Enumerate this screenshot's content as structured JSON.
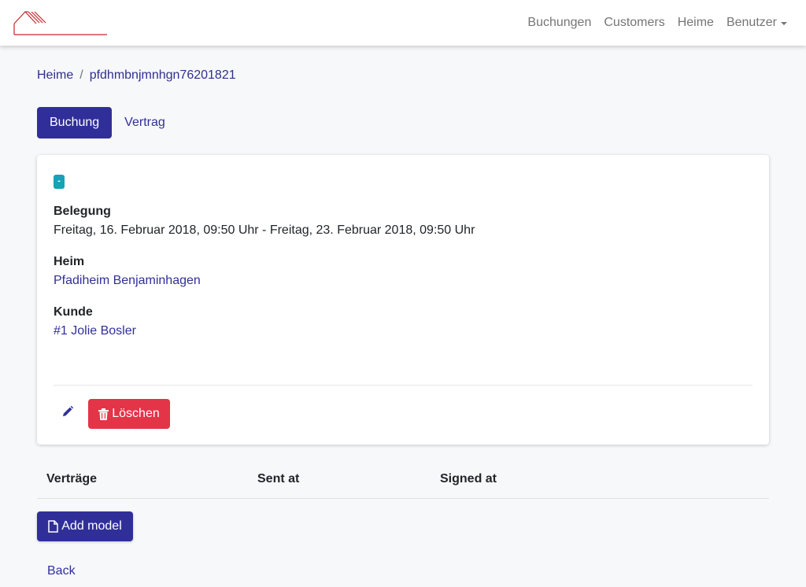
{
  "navbar": {
    "logo_icon": "house-roof-logo",
    "links": [
      {
        "label": "Buchungen"
      },
      {
        "label": "Customers"
      },
      {
        "label": "Heime"
      },
      {
        "label": "Benutzer",
        "has_dropdown": true
      }
    ]
  },
  "breadcrumb": {
    "parent": "Heime",
    "separator": "/",
    "current": "pfdhmbnjmnhgn76201821"
  },
  "tabs": [
    {
      "label": "Buchung",
      "active": true
    },
    {
      "label": "Vertrag",
      "active": false
    }
  ],
  "booking": {
    "status_badge": "-",
    "belegung_label": "Belegung",
    "belegung_value": "Freitag, 16. Februar 2018, 09:50 Uhr - Freitag, 23. Februar 2018, 09:50 Uhr",
    "heim_label": "Heim",
    "heim_value": "Pfadiheim Benjaminhagen",
    "kunde_label": "Kunde",
    "kunde_value": "#1 Jolie Bosler",
    "edit_icon": "pencil-icon",
    "delete_label": "Löschen",
    "delete_icon": "trash-icon"
  },
  "contracts_table": {
    "columns": [
      "Verträge",
      "Sent at",
      "Signed at"
    ]
  },
  "add_model_label": "Add model",
  "add_model_icon": "file-icon",
  "back_label": "Back",
  "colors": {
    "primary": "#302f9a",
    "danger": "#e33448",
    "info": "#17a2b8",
    "logo_red": "#c9262c"
  }
}
